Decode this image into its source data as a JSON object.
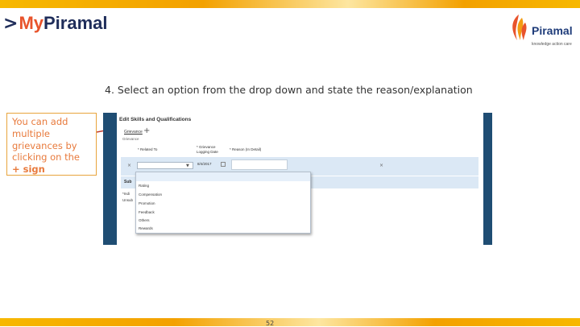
{
  "brand": {
    "chevron": ">",
    "my": "My",
    "piramal": "Piramal"
  },
  "logo": {
    "name": "Piramal",
    "tagline": "knowledge action care"
  },
  "instruction": "4. Select an option from the drop down and state the reason/explanation",
  "callout": {
    "text_lines": [
      "You can add",
      "multiple",
      "grievances by",
      "clicking on the"
    ],
    "plus_sign": "+ sign"
  },
  "screenshot": {
    "title": "Edit Skills and Qualifications",
    "section": "Grievance",
    "add_symbol": "+",
    "sub_label": "Grievance",
    "columns": {
      "related_to": "* Related To",
      "grievance_logging_date": "* Grievance Logging Date",
      "reason": "* Reason (In Detail)"
    },
    "row": {
      "remove_symbol": "×",
      "date_value": "8/4/2017",
      "remove_symbol_right": "×"
    },
    "submit_partial": "Sub",
    "note_1": "*Indi",
    "note_2": "Unsub",
    "dropdown_options": [
      "",
      "Rating",
      "Compensation",
      "Promotion",
      "Feedback",
      "Others",
      "Rewards"
    ]
  },
  "page_number": "52",
  "colors": {
    "brand_orange": "#e8532b",
    "brand_navy": "#1f2d5a",
    "callout_text": "#e87a3c",
    "callout_border": "#e8a43c",
    "arrow": "#c0392b",
    "frame_blue": "#1f4d73"
  }
}
